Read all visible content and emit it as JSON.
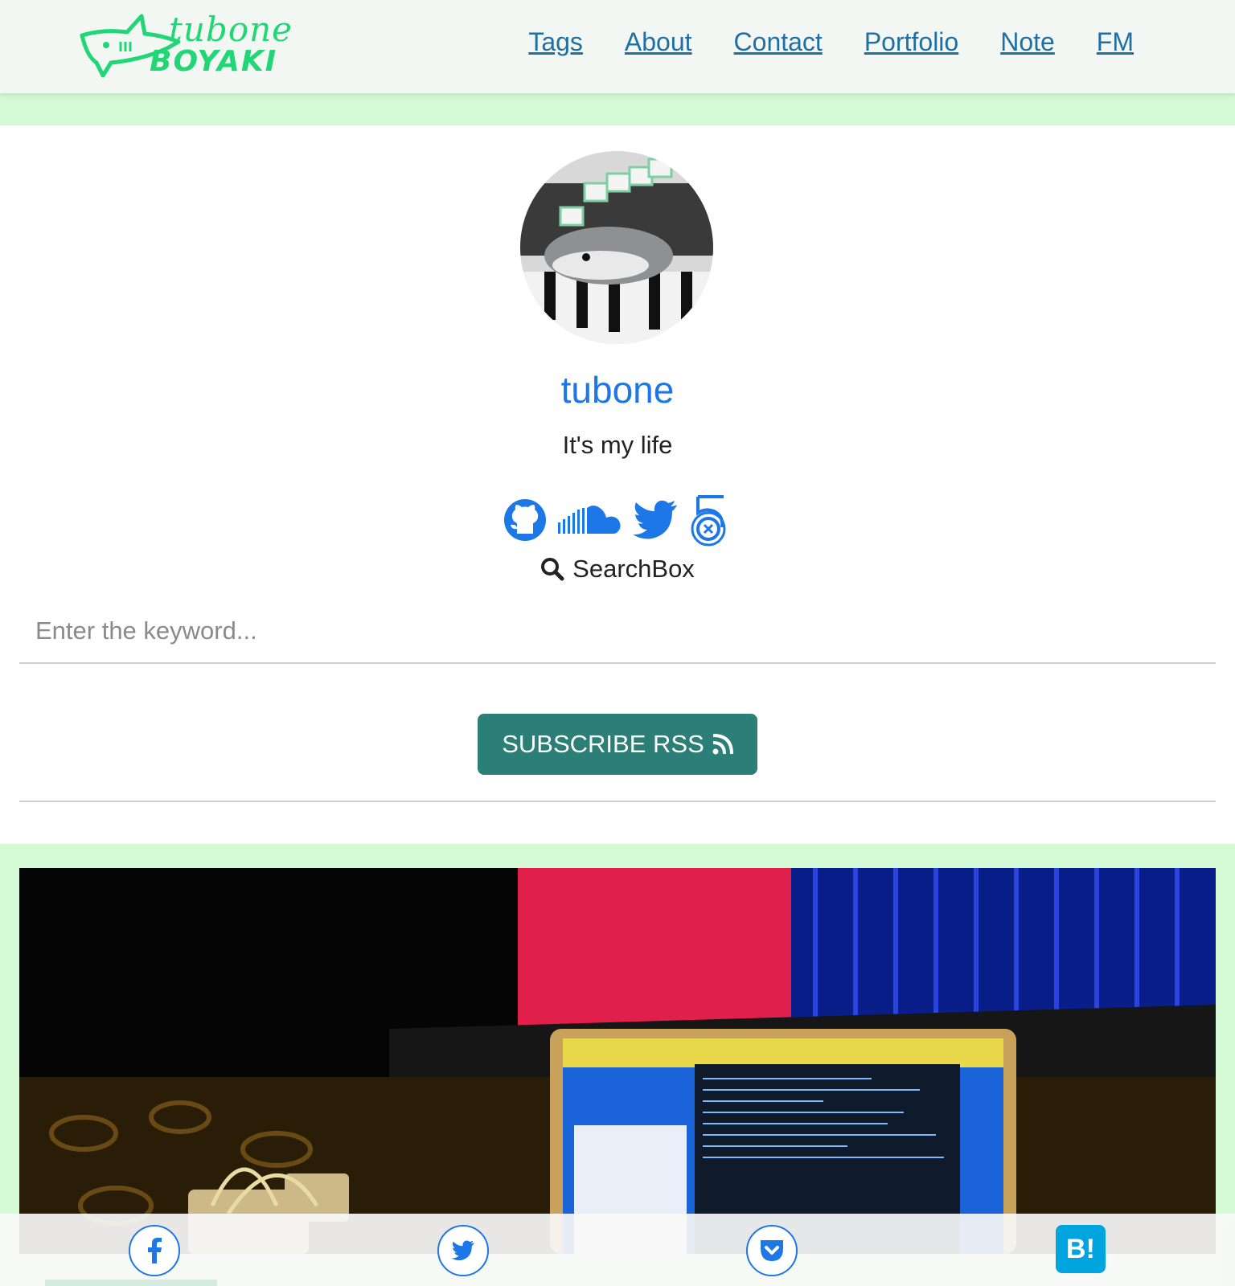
{
  "header": {
    "logo_line1": "tubone",
    "logo_line2": "BOYAKI",
    "nav": [
      {
        "label": "Tags"
      },
      {
        "label": "About"
      },
      {
        "label": "Contact"
      },
      {
        "label": "Portfolio"
      },
      {
        "label": "Note"
      },
      {
        "label": "FM"
      }
    ]
  },
  "profile": {
    "name": "tubone",
    "tagline": "It's my life",
    "social_icons": [
      "github-icon",
      "soundcloud-icon",
      "twitter-icon",
      "500px-icon"
    ]
  },
  "search": {
    "label": "SearchBox",
    "placeholder": "Enter the keyword...",
    "value": ""
  },
  "rss": {
    "label": "SUBSCRIBE RSS"
  },
  "share": {
    "icons": [
      "facebook-icon",
      "twitter-icon",
      "pocket-icon",
      "hatena-bookmark-icon"
    ],
    "hatena_label": "B!"
  },
  "colors": {
    "brand_green": "#20d675",
    "page_bg": "#d4fad6",
    "link": "#1f6fa3",
    "accent_blue": "#1d77e6",
    "rss_button": "#2b7f76",
    "hatena": "#00a4de"
  }
}
